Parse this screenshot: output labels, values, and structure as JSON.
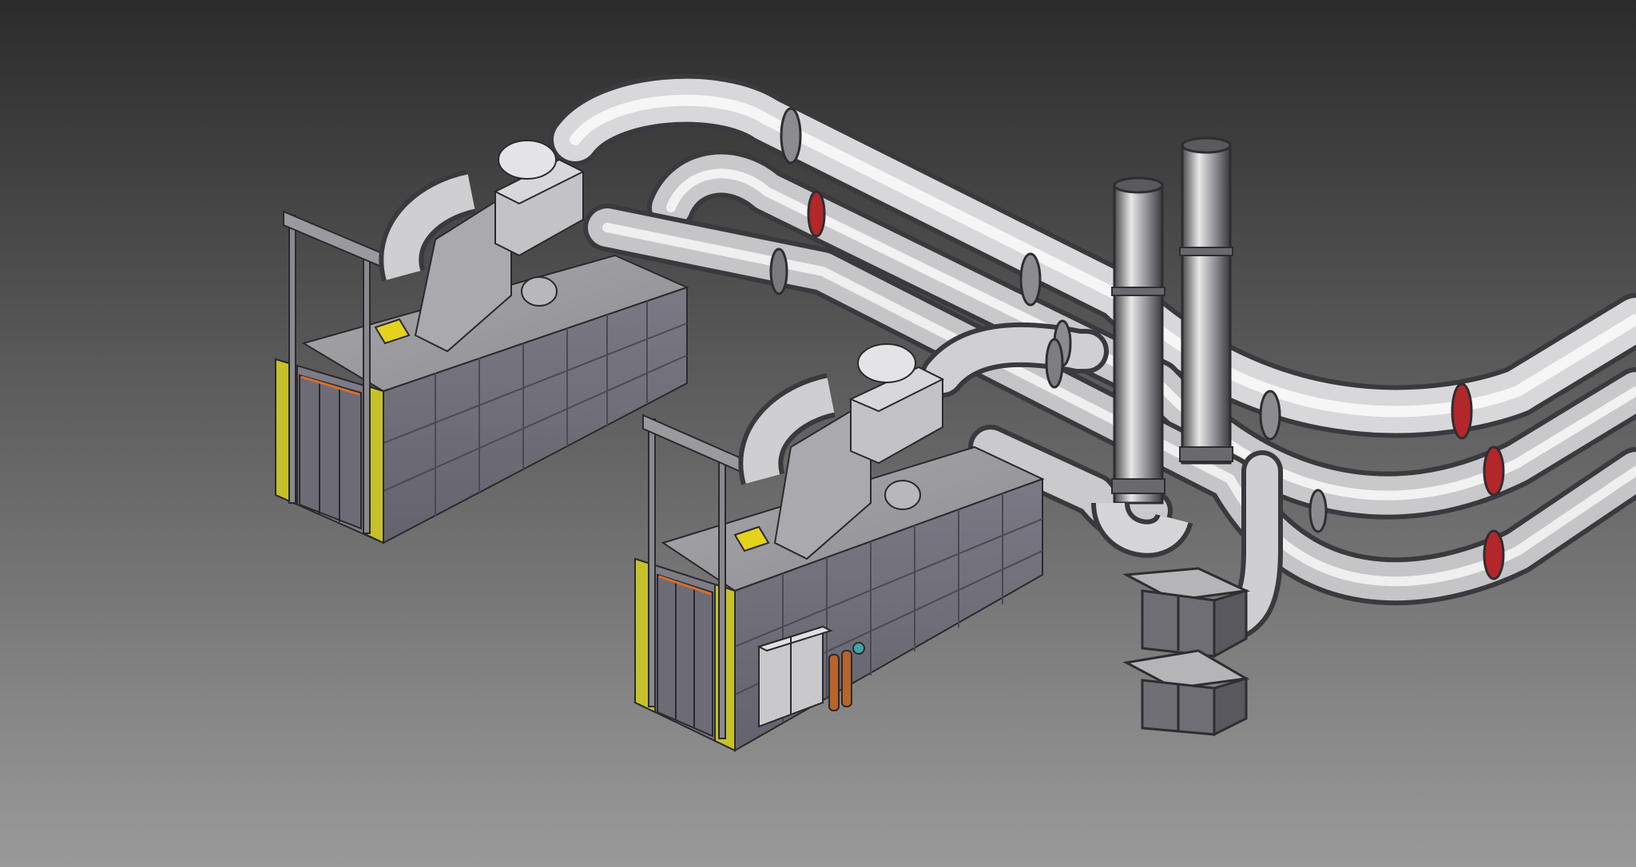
{
  "scene": {
    "background_top": "#2b2b2b",
    "background_bottom": "#9a9a9a",
    "furnaces": [
      {
        "name": "furnace-left",
        "panel_color": "#6f6e78",
        "door_frame_color": "#c6c12a"
      },
      {
        "name": "furnace-right",
        "panel_color": "#6f6e78",
        "door_frame_color": "#c6c12a"
      }
    ],
    "colors": {
      "pipe_light": "#f2f2f2",
      "pipe_mid": "#a9a9ad",
      "pipe_dark": "#4a4a4e",
      "flange_red": "#b3262a",
      "gas_bottle": "#b8642a",
      "warning_yellow": "#e5d21c"
    },
    "stacks": 2,
    "hoods": 2
  }
}
